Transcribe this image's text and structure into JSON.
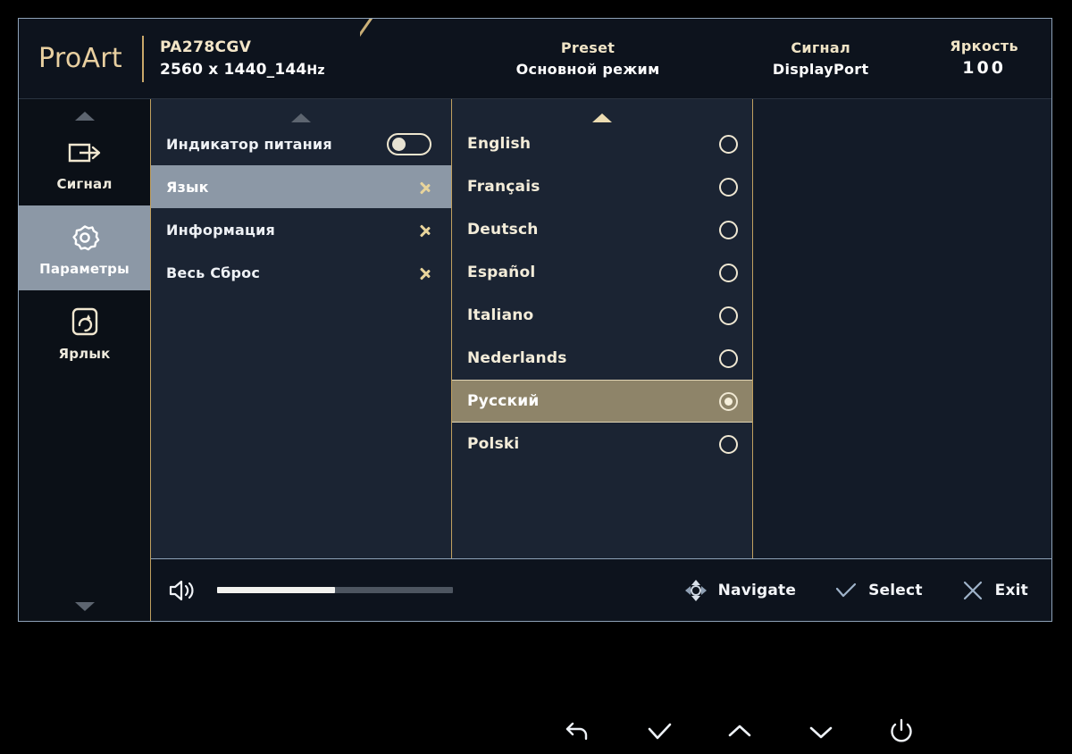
{
  "header": {
    "brand": "ProArt",
    "model": "PA278CGV",
    "resolution": "2560 x 1440_144",
    "refresh_unit": "Hz",
    "stats": [
      {
        "key": "Preset",
        "value": "Основной режим",
        "name": "preset"
      },
      {
        "key": "Сигнал",
        "value": "DisplayPort",
        "name": "signal"
      },
      {
        "key": "Яркость",
        "value": "100",
        "name": "brightness"
      }
    ]
  },
  "sidebar": {
    "items": [
      {
        "label": "Сигнал",
        "icon": "input-signal-icon",
        "active": false
      },
      {
        "label": "Параметры",
        "icon": "gear-icon",
        "active": true
      },
      {
        "label": "Ярлык",
        "icon": "shortcut-icon",
        "active": false
      }
    ],
    "scroll_up": "scroll-up-arrow",
    "scroll_down": "scroll-down-arrow"
  },
  "menu": {
    "rows": [
      {
        "label": "Индикатор питания",
        "control": "toggle",
        "toggle_on": false,
        "selected": false
      },
      {
        "label": "Язык",
        "control": "chevron",
        "selected": true
      },
      {
        "label": "Информация",
        "control": "chevron",
        "selected": false
      },
      {
        "label": "Весь Сброс",
        "control": "chevron",
        "selected": false
      }
    ]
  },
  "languages": {
    "selected": "Русский",
    "rows": [
      {
        "label": "English",
        "checked": false
      },
      {
        "label": "Français",
        "checked": false
      },
      {
        "label": "Deutsch",
        "checked": false
      },
      {
        "label": "Español",
        "checked": false
      },
      {
        "label": "Italiano",
        "checked": false
      },
      {
        "label": "Nederlands",
        "checked": false
      },
      {
        "label": "Русский",
        "checked": true
      },
      {
        "label": "Polski",
        "checked": false
      }
    ]
  },
  "footer": {
    "volume_icon": "speaker-icon",
    "volume_percent": 50,
    "hints": [
      {
        "label": "Navigate",
        "icon": "dpad-icon"
      },
      {
        "label": "Select",
        "icon": "check-icon"
      },
      {
        "label": "Exit",
        "icon": "close-icon"
      }
    ]
  },
  "controls": {
    "buttons": [
      {
        "icon": "back-arrow-icon",
        "name": "back-button"
      },
      {
        "icon": "check-icon",
        "name": "confirm-button"
      },
      {
        "icon": "chevron-up-icon",
        "name": "up-button"
      },
      {
        "icon": "chevron-down-icon",
        "name": "down-button"
      },
      {
        "icon": "power-icon",
        "name": "power-button"
      }
    ]
  },
  "colors": {
    "panel_bg": "#1b2433",
    "accent_gold": "#e8d49b",
    "highlight_grey": "#8c98a6",
    "highlight_gold": "#8e8469"
  }
}
